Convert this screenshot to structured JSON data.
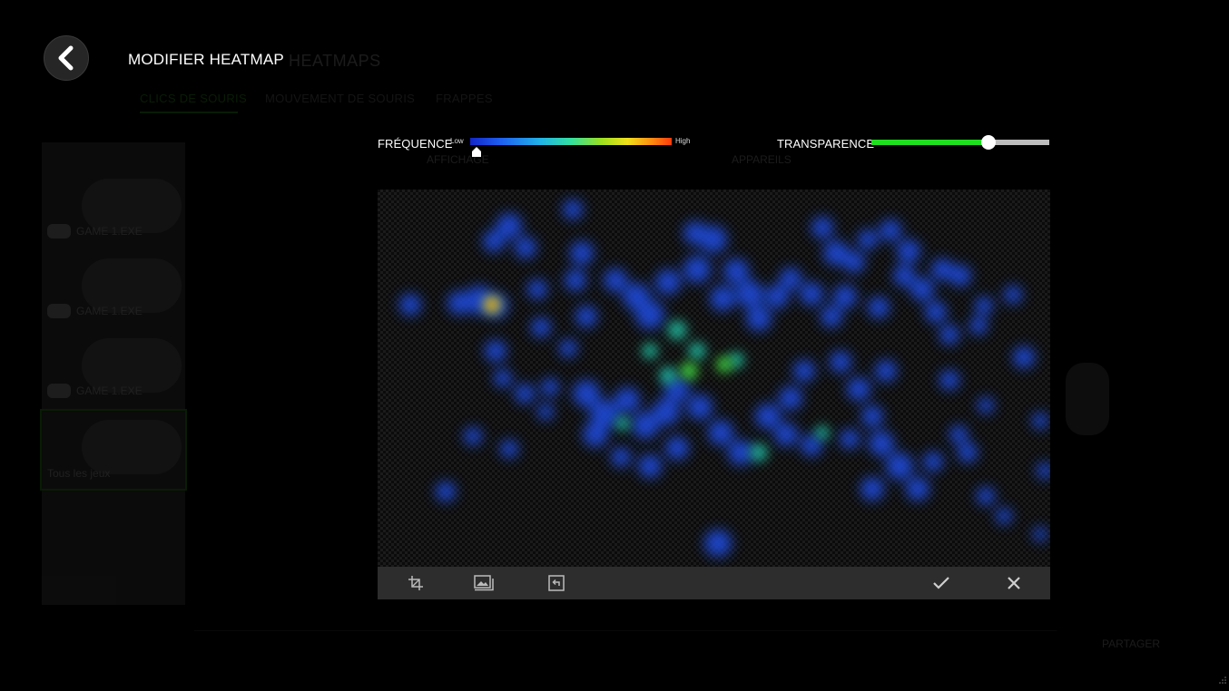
{
  "background_app": {
    "title": "HEATMAPS",
    "tabs": [
      {
        "label": "CLICS DE SOURIS",
        "active": true
      },
      {
        "label": "MOUVEMENT DE SOURIS",
        "active": false
      },
      {
        "label": "FRAPPES",
        "active": false
      }
    ],
    "games": [
      {
        "label": "GAME 1.EXE"
      },
      {
        "label": "GAME 1.EXE"
      },
      {
        "label": "GAME 1.EXE"
      },
      {
        "label": "Tous les jeux",
        "selected": true
      }
    ],
    "display_label": "AFFICHAGE",
    "devices_label": "APPAREILS",
    "share_label": "PARTAGER"
  },
  "header": {
    "back_icon": "chevron-left-icon",
    "title": "MODIFIER HEATMAP"
  },
  "controls": {
    "frequency": {
      "label": "FRÉQUENCE",
      "low_label": "Low",
      "high_label": "High",
      "value": 0.03
    },
    "transparency": {
      "label": "TRANSPARENCE",
      "value": 0.66
    }
  },
  "toolbar": {
    "buttons": [
      {
        "icon": "crop-icon"
      },
      {
        "icon": "image-background-icon"
      },
      {
        "icon": "reset-icon"
      },
      {
        "icon": "confirm-check-icon"
      },
      {
        "icon": "close-icon"
      }
    ]
  },
  "colors": {
    "accent": "#44d62c",
    "transparency_fill": "#1fe01f",
    "toolbar_bg": "#2d2d2d",
    "heat_low": "#1e4ff0",
    "heat_mid": "#2ee0b0",
    "heat_high": "#ff3a0c"
  }
}
